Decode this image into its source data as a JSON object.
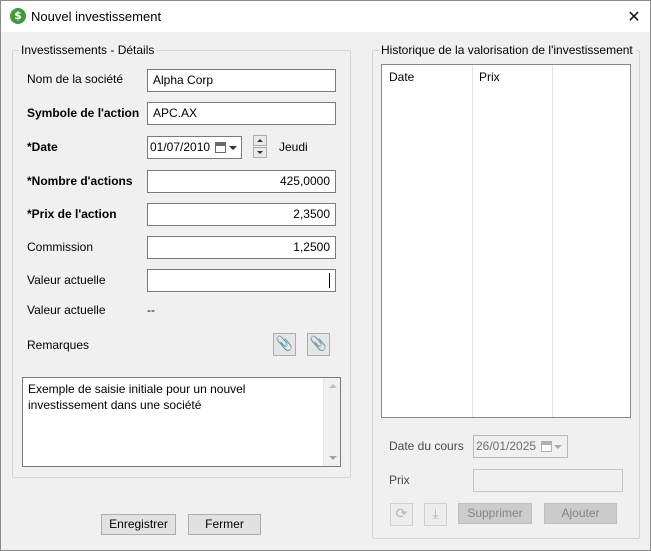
{
  "window": {
    "title": "Nouvel investissement",
    "icon_glyph": "$",
    "close_glyph": "✕"
  },
  "details": {
    "legend": "Investissements - Détails",
    "company_label": "Nom de la société",
    "company_value": "Alpha Corp",
    "symbol_label": "Symbole de l'action",
    "symbol_value": "APC.AX",
    "date_label": "*Date",
    "date_value": "01/07/2010",
    "weekday": "Jeudi",
    "shares_label": "*Nombre d'actions",
    "shares_value": "425,0000",
    "price_label": "*Prix de l'action",
    "price_value": "2,3500",
    "commission_label": "Commission",
    "commission_value": "1,2500",
    "current_value_label": "Valeur actuelle",
    "current_value_input": "",
    "current_value_label2": "Valeur actuelle",
    "current_value_display": "--",
    "remarks_label": "Remarques",
    "attach_icon_glyph": "📎",
    "remarks_text": "Exemple de saisie initiale pour un nouvel investissement dans une société"
  },
  "footer": {
    "save_label": "Enregistrer",
    "close_label": "Fermer"
  },
  "history": {
    "legend": "Historique de la valorisation de l'investissement",
    "columns": [
      "Date",
      "Prix"
    ],
    "quote_date_label": "Date du cours",
    "quote_date_value": "26/01/2025",
    "price_label": "Prix",
    "price_value": "",
    "refresh_icon_glyph": "⟳",
    "download_icon_glyph": "⤓",
    "delete_label": "Supprimer",
    "add_label": "Ajouter"
  },
  "colors": {
    "accent_green": "#3f9b3a",
    "border": "#7a7a7a",
    "background": "#f0f0f0"
  }
}
